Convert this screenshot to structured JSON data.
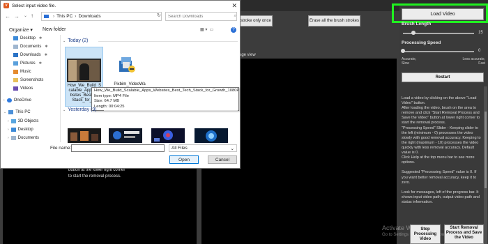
{
  "app": {
    "toolbar": {
      "stroke_only_label": "stroke only once",
      "erase_all_label": "Erase all the brush strokes"
    },
    "panel_label": "age view",
    "video_hint": [
      "button at the lower right corner",
      "to start the removal process."
    ],
    "load_video_label": "Load Video",
    "brush_length": {
      "label": "Brush Length",
      "value": "15",
      "fraction": 0.15
    },
    "processing_speed": {
      "label": "Processing Speed",
      "value": "0",
      "fraction": 0.0,
      "left_end": [
        "Accurate,",
        "Slow"
      ],
      "right_end": [
        "Less accurate,",
        "Fast"
      ]
    },
    "restart_label": "Restart",
    "help_text": "Load a video by clicking on the above \"Load Video\" button.\nAfter loading the video, brush on the area to remove and click \"Start Removal Process and Save the Video\" button at lower right corner to start the removal process.\n\"Processing Speed\" Slider - Keeping slider to the left (minimum - 0) processes the video slowly with good removal accuracy. Keeping to the right (maximum - 10) processes the video quickly with less removal accuracy. Default value is 0.\nClick Help at the top menu bar to see more options.\n\nSuggested \"Processing Speed\" value is 0. If you want better removal accuracy, keep it to zero.\n\nLook for messages, left of the progress bar. It shows input video path, output video path and status information.",
    "stop_label": [
      "Stop Processing",
      "Video"
    ],
    "start_label": [
      "Start Removal",
      "Process and Save",
      "the Video"
    ],
    "watermark": {
      "title": "Activate Windows",
      "sub": "Go to Settings to activate Windows."
    },
    "colors": {
      "highlight_frame": "#20f020",
      "video_bg": "#000000",
      "panel_bg": "#3a3a3a"
    }
  },
  "dialog": {
    "title": "Select input video file.",
    "breadcrumb": [
      "This PC",
      "Downloads"
    ],
    "search_placeholder": "Search Downloads",
    "organize_label": "Organize ▾",
    "new_folder_label": "New folder",
    "nav": {
      "quick": [
        {
          "label": "Desktop",
          "pinned": true,
          "icon": "desktop-icon"
        },
        {
          "label": "Documents",
          "pinned": true,
          "icon": "documents-icon"
        },
        {
          "label": "Downloads",
          "pinned": true,
          "icon": "downloads-icon"
        },
        {
          "label": "Pictures",
          "pinned": true,
          "icon": "pictures-icon"
        },
        {
          "label": "Music",
          "pinned": false,
          "icon": "music-icon"
        },
        {
          "label": "Screenshots",
          "pinned": false,
          "icon": "screenshots-icon"
        },
        {
          "label": "Videos",
          "pinned": false,
          "icon": "videos-icon"
        }
      ],
      "onedrive": "OneDrive",
      "thispc": "This PC",
      "pc_items": [
        "3D Objects",
        "Desktop",
        "Documents"
      ]
    },
    "groups": {
      "today": "Today (2)",
      "yesterday": "Yesterday (9)"
    },
    "files": [
      {
        "name": [
          "How_We_Build_S",
          "calable_Apps_W",
          "bsites_Best_Te",
          "Stack_for_Gr"
        ],
        "type": "video"
      },
      {
        "name": [
          "Pixbim_VideoWa"
        ],
        "type": "installer"
      }
    ],
    "tooltip": [
      "How_We_Build_Scalable_Apps_Websites_Best_Tech_Stack_for_Growth_1080P",
      "Item type: MP4 File",
      "Size: 64.7 MB",
      "Length: 00:04:25"
    ],
    "filename_label": "File name:",
    "filename_value": "",
    "filetype_value": "All Files",
    "open_label": "Open",
    "cancel_label": "Cancel"
  }
}
